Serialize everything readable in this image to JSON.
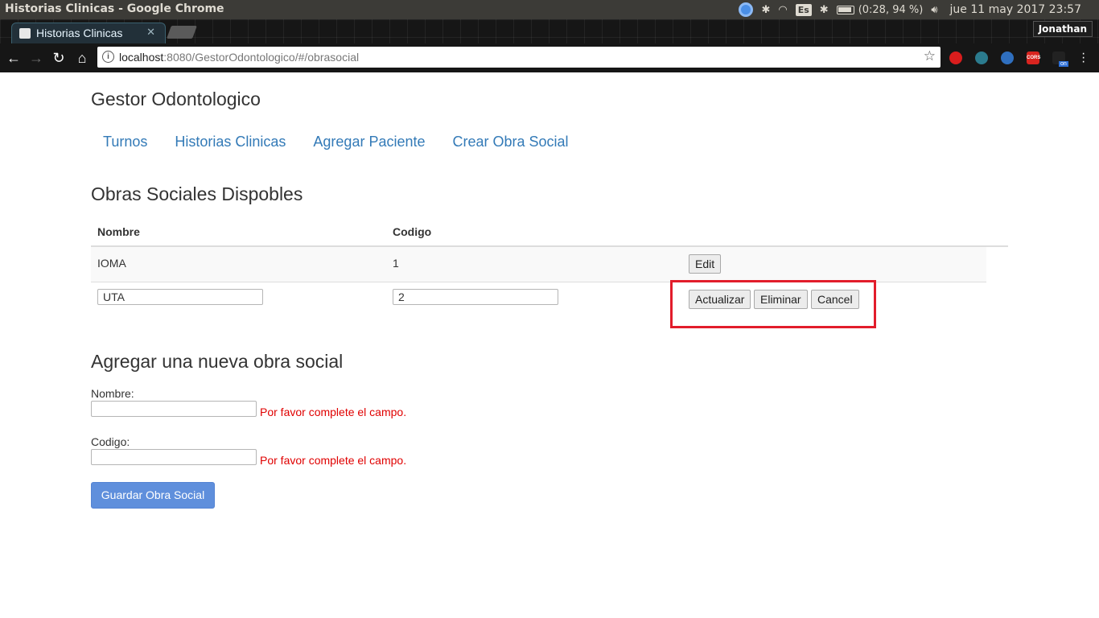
{
  "os": {
    "window_title": "Historias Clinicas - Google Chrome",
    "battery": "(0:28, 94 %)",
    "keyboard_layout": "Es",
    "clock": "jue 11 may 2017 23:57"
  },
  "browser": {
    "tab_title": "Historias Clinicas",
    "tab_close": "✕",
    "profile_name": "Jonathan",
    "url_host": "localhost",
    "url_path": ":8080/GestorOdontologico/#/obrasocial",
    "extension_cors_label": "CORS",
    "extension_on_label": "on"
  },
  "app": {
    "brand": "Gestor Odontologico",
    "nav": [
      "Turnos",
      "Historias Clinicas",
      "Agregar Paciente",
      "Crear Obra Social"
    ]
  },
  "list": {
    "heading": "Obras Sociales Dispobles",
    "columns": [
      "Nombre",
      "Codigo"
    ],
    "rows": [
      {
        "nombre": "IOMA",
        "codigo": "1",
        "edit_label": "Edit"
      },
      {
        "nombre": "UTA",
        "codigo": "2",
        "update_label": "Actualizar",
        "delete_label": "Eliminar",
        "cancel_label": "Cancel"
      }
    ]
  },
  "form": {
    "heading": "Agregar una nueva obra social",
    "nombre_label": "Nombre:",
    "codigo_label": "Codigo:",
    "required_msg": "Por favor complete el campo.",
    "submit_label": "Guardar Obra Social"
  },
  "colors": {
    "link": "#337ab7",
    "error": "#e00000",
    "highlight": "#e21d2b",
    "primary_button": "#5f8fdc"
  }
}
